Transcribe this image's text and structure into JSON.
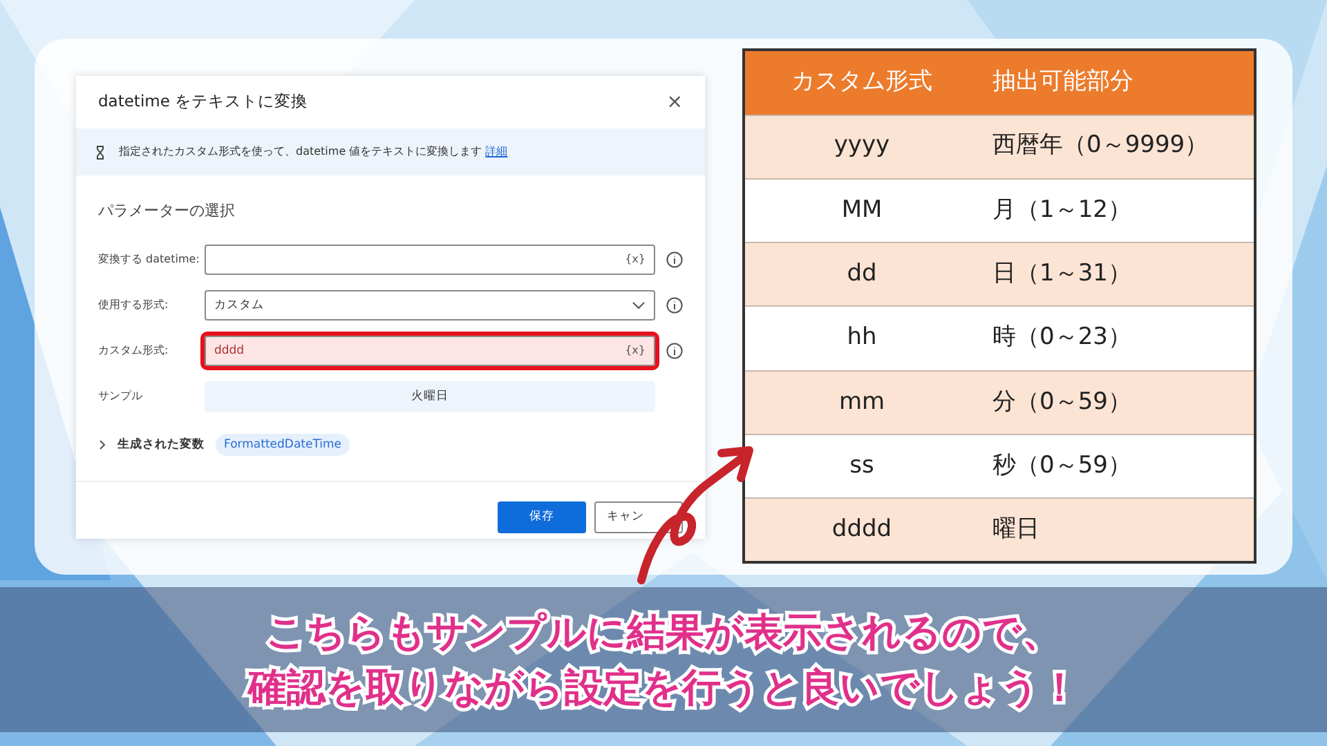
{
  "dialog": {
    "title": "datetime をテキストに変換",
    "close": "×",
    "description": "指定されたカスタム形式を使って、datetime 値をテキストに変換します",
    "description_link": "詳細",
    "section_title": "パラメーターの選択",
    "fields": [
      {
        "kind": "text",
        "label": "変換する datetime:",
        "suffix": "{x}",
        "highlighted": false
      },
      {
        "kind": "dropdown",
        "label": "使用する形式:",
        "value": "カスタム",
        "highlighted": false
      },
      {
        "kind": "text",
        "label": "カスタム形式:",
        "value": "dddd",
        "suffix": "{x}",
        "highlighted": true
      },
      {
        "kind": "output",
        "label": "サンプル",
        "value": "火曜日",
        "highlighted": false
      }
    ],
    "generated_variables": {
      "label": "生成された変数",
      "expanded": false,
      "variable": "FormattedDateTime"
    },
    "buttons": [
      {
        "label": "保存",
        "primary": true
      },
      {
        "label": "キャン",
        "primary": false
      }
    ]
  },
  "table": {
    "columns": [
      "カスタム形式",
      "抽出可能部分"
    ],
    "rows": [
      {
        "format": "yyyy",
        "part": "西暦年（0～9999）"
      },
      {
        "format": "MM",
        "part": "月（1～12）"
      },
      {
        "format": "dd",
        "part": "日（1～31）"
      },
      {
        "format": "hh",
        "part": "時（0～23）"
      },
      {
        "format": "mm",
        "part": "分（0～59）"
      },
      {
        "format": "ss",
        "part": "秒（0～59）"
      },
      {
        "format": "dddd",
        "part": "曜日"
      }
    ]
  },
  "caption": [
    "こちらもサンプルに結果が表示されるので、",
    "確認を取りながら設定を行うと良いでしょう！"
  ]
}
